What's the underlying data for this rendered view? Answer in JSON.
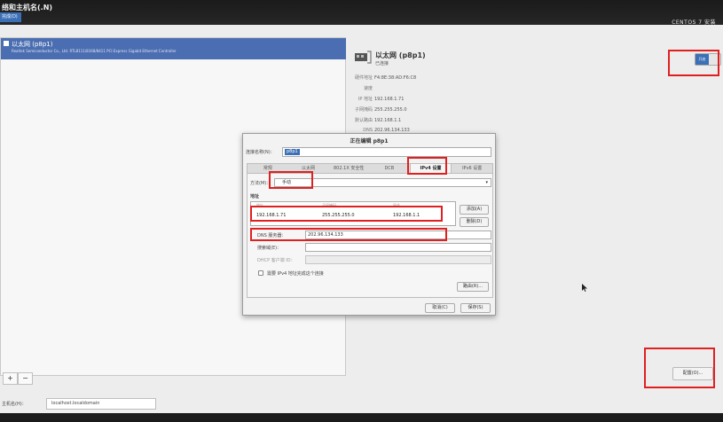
{
  "topbar": {
    "title": "络和主机名(.N)",
    "done_label": "完成(D)",
    "product": "CENTOS 7 安装",
    "keyboard_label": "us",
    "help_label": "帮助"
  },
  "device": {
    "name": "以太网 (p8p1)",
    "description": "Realtek Semiconductor Co., Ltd. RTL8111/8168/8411 PCI Express Gigabit Ethernet Controller",
    "status": "已连接",
    "hw_label": "硬件地址",
    "hw_value": "F4:8E:38:AD:F6:C8",
    "speed_label": "速度",
    "ip_label": "IP 地址",
    "ip_value": "192.168.1.71",
    "mask_label": "子网掩码",
    "mask_value": "255.255.255.0",
    "gw_label": "默认路由",
    "gw_value": "192.168.1.1",
    "dns_label": "DNS",
    "dns_value": "202.96.134.133"
  },
  "toggle_label": "开启",
  "configure_label": "配置(O)...",
  "add_label": "+",
  "remove_label": "−",
  "hostname": {
    "label": "主机名(H)：",
    "value": "localhost.localdomain"
  },
  "dialog": {
    "title": "正在编辑 p8p1",
    "conn_name_label": "连接名称(N)：",
    "conn_name_value": "p8p1",
    "tabs": [
      "常规",
      "以太网",
      "802.1X 安全性",
      "DCB",
      "IPv4 设置",
      "IPv6 设置"
    ],
    "method_label": "方法(M)：",
    "method_value": "手动",
    "addr_label": "地址",
    "col_address": "地址",
    "col_netmask": "子网掩码",
    "col_gateway": "网关",
    "addr_ip": "192.168.1.71",
    "addr_mask": "255.255.255.0",
    "addr_gw": "192.168.1.1",
    "add_btn": "添加(A)",
    "delete_btn": "删除(D)",
    "dns_label": "DNS 服务器：",
    "dns_value": "202.96.134.133",
    "search_label": "搜索域(E)：",
    "dhcp_label": "DHCP 客户端 ID：",
    "require_label": "需要 IPv4 地址完成这个连接",
    "routes_btn": "路由(R)...",
    "cancel_btn": "取消(C)",
    "save_btn": "保存(S)"
  }
}
